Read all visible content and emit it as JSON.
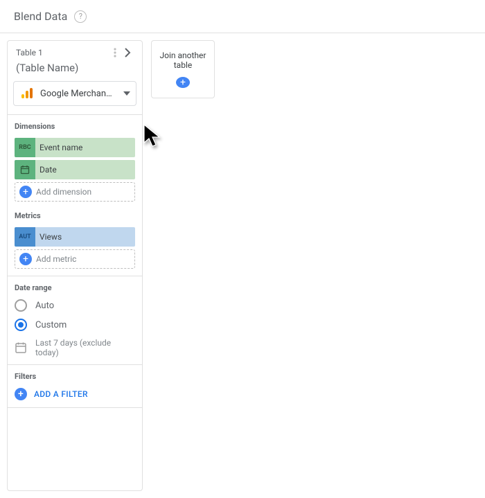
{
  "header": {
    "title": "Blend Data"
  },
  "table": {
    "title": "Table 1",
    "name_placeholder": "(Table Name)",
    "source_label": "Google Merchan…"
  },
  "dimensions": {
    "label": "Dimensions",
    "items": [
      {
        "type_label": "RBC",
        "name": "Event name"
      },
      {
        "type_label": "date",
        "name": "Date"
      }
    ],
    "add_label": "Add dimension"
  },
  "metrics": {
    "label": "Metrics",
    "items": [
      {
        "type_label": "AUT",
        "name": "Views"
      }
    ],
    "add_label": "Add metric"
  },
  "date_range": {
    "label": "Date range",
    "auto_label": "Auto",
    "custom_label": "Custom",
    "selected": "custom",
    "value_text": "Last 7 days (exclude today)"
  },
  "filters": {
    "label": "Filters",
    "add_label": "ADD A FILTER"
  },
  "join": {
    "label": "Join another table"
  }
}
